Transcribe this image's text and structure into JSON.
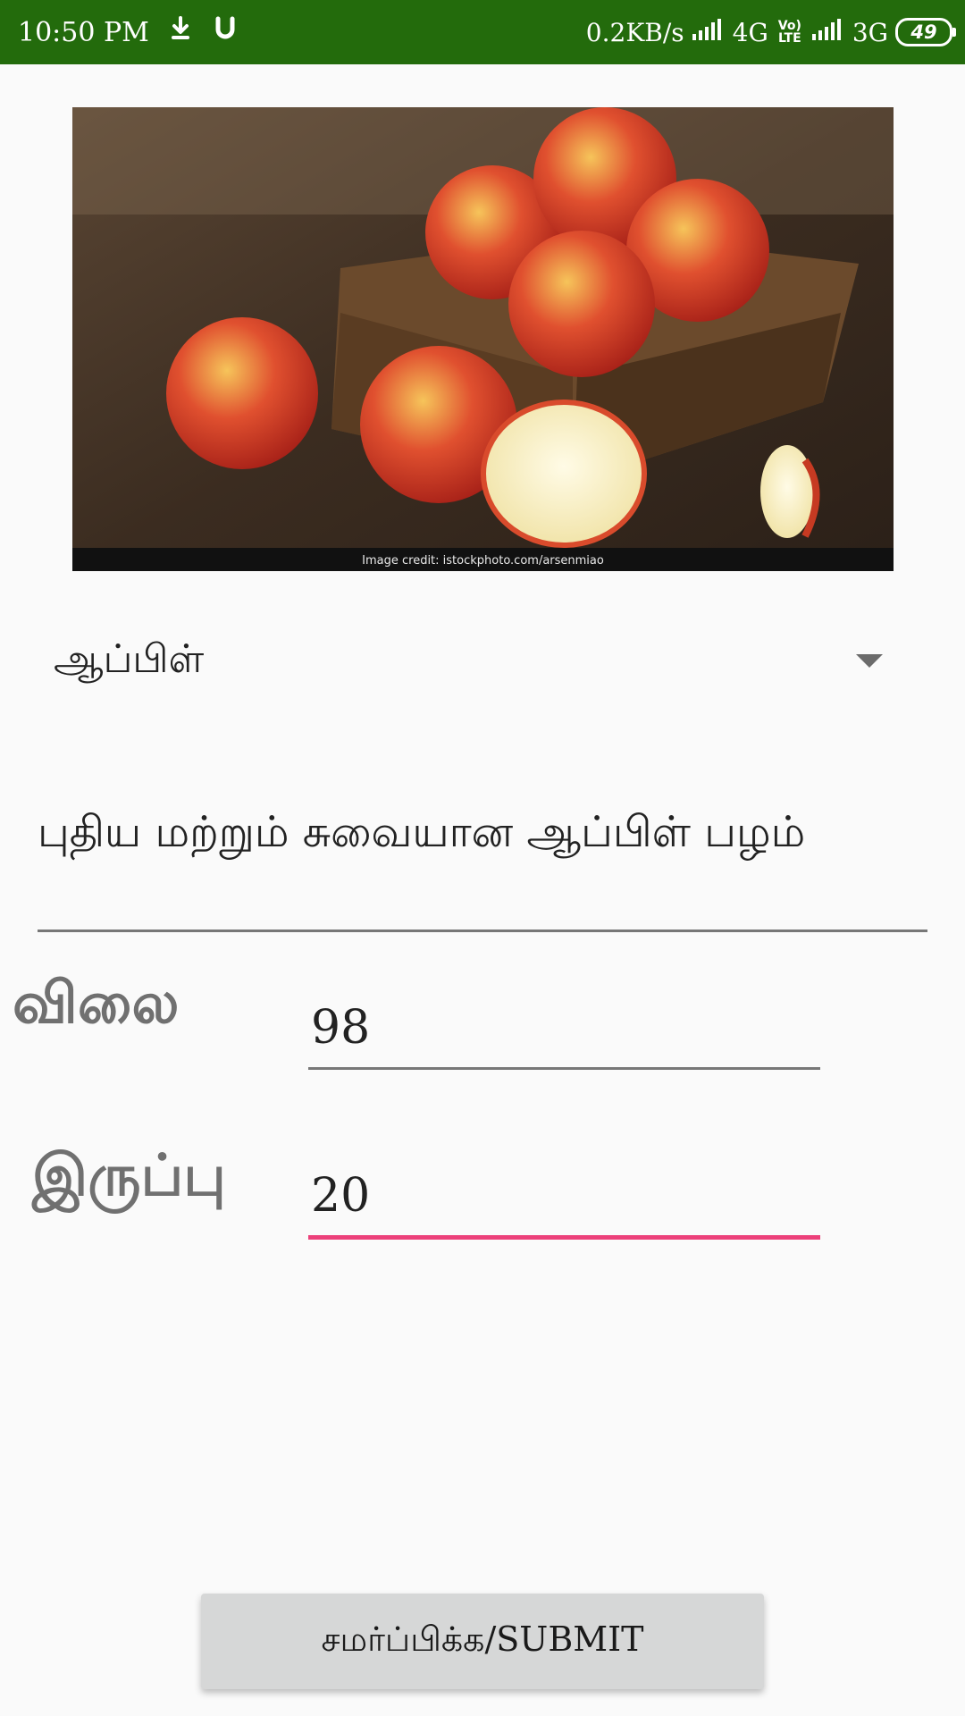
{
  "status_bar": {
    "time": "10:50 PM",
    "net_speed": "0.2KB/s",
    "network_1": "4G",
    "volte_line1": "Vo)",
    "volte_line2": "LTE",
    "network_2": "3G",
    "battery": "49",
    "icons": [
      "download-icon",
      "magnet-icon",
      "signal-icon",
      "volte-icon",
      "signal-icon",
      "battery-icon"
    ]
  },
  "product": {
    "image_icon": "apple-photo",
    "image_credit": "Image credit: istockphoto.com/arsenmiao"
  },
  "spinner": {
    "selected": "ஆப்பிள்"
  },
  "description": {
    "value": "புதிய மற்றும் சுவையான ஆப்பிள் பழம்"
  },
  "price": {
    "label": "விலை",
    "value": "98"
  },
  "stock": {
    "label": "இருப்பு",
    "value": "20"
  },
  "submit": {
    "label": "சமர்ப்பிக்க/SUBMIT"
  },
  "colors": {
    "status_bar": "#236b0c",
    "focused_underline": "#ec407a",
    "button": "#d6d7d7"
  }
}
